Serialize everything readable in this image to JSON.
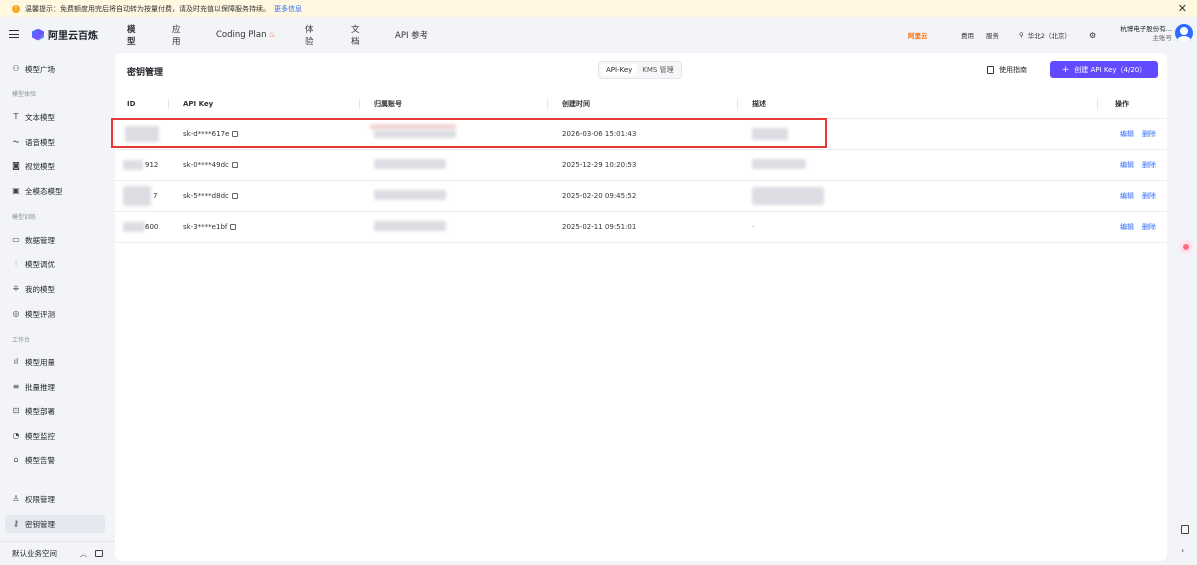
{
  "notice": {
    "text": "温馨提示：免费额度用完后将自动转为按量付费，请及时充值以保障服务持续。",
    "more": "更多信息"
  },
  "header": {
    "brand": "阿里云百炼",
    "nav": [
      "模型",
      "应用",
      "Coding Plan",
      "体验",
      "文档",
      "API 参考"
    ],
    "tools": [
      "阿里云",
      "费用",
      "服务",
      "华北2（北京）"
    ],
    "account_name": "杭博电子股份有...",
    "account_role": "主账号"
  },
  "sidebar": {
    "groups": [
      "模型体验",
      "模型训练",
      "工作台"
    ],
    "items": [
      {
        "label": "模型广场",
        "icon": "model-plaza-icon",
        "glyph": "⚇"
      },
      {
        "label": "文本模型",
        "icon": "text-icon",
        "glyph": "T"
      },
      {
        "label": "语音模型",
        "icon": "audio-wave-icon",
        "glyph": "⏦"
      },
      {
        "label": "视觉模型",
        "icon": "camera-icon",
        "glyph": "◙"
      },
      {
        "label": "全模态模型",
        "icon": "multimodal-icon",
        "glyph": "▣"
      },
      {
        "label": "数据管理",
        "icon": "data-icon",
        "glyph": "▭"
      },
      {
        "label": "模型调优",
        "icon": "tuning-icon",
        "glyph": "⫶"
      },
      {
        "label": "我的模型",
        "icon": "my-models-icon",
        "glyph": "⁜"
      },
      {
        "label": "模型评测",
        "icon": "evaluation-icon",
        "glyph": "◎"
      },
      {
        "label": "模型用量",
        "icon": "usage-chart-icon",
        "glyph": "ıl"
      },
      {
        "label": "批量推理",
        "icon": "batch-icon",
        "glyph": "≡"
      },
      {
        "label": "模型部署",
        "icon": "deploy-icon",
        "glyph": "⊡"
      },
      {
        "label": "模型监控",
        "icon": "monitor-icon",
        "glyph": "◔"
      },
      {
        "label": "模型告警",
        "icon": "alert-icon",
        "glyph": "⌂"
      },
      {
        "label": "权限管理",
        "icon": "user-icon",
        "glyph": "♙"
      },
      {
        "label": "密钥管理",
        "icon": "key-icon",
        "glyph": "⚷"
      }
    ],
    "workspace": "默认业务空间"
  },
  "page": {
    "title": "密钥管理",
    "tabs": [
      "API-Key",
      "KMS 管理"
    ],
    "guide": "使用指南",
    "create": "创建 API Key（4/20）"
  },
  "table": {
    "headers": [
      "ID",
      "API Key",
      "归属账号",
      "创建时间",
      "描述",
      "操作"
    ],
    "rows": [
      {
        "id": "",
        "key": "sk-d****617e",
        "created": "2026-03-06 15:01:43",
        "desc": ""
      },
      {
        "id": "912",
        "key": "sk-0****49dc",
        "created": "2025-12-29 10:20:53",
        "desc": ""
      },
      {
        "id": "7",
        "key": "sk-5****d8dc",
        "created": "2025-02-20 09:45:52",
        "desc": ""
      },
      {
        "id": "600",
        "key": "sk-3****e1bf",
        "created": "2025-02-11 09:51:01",
        "desc": "-"
      }
    ],
    "actions": [
      "编辑",
      "删除"
    ]
  },
  "colors": {
    "accent": "#624aff",
    "link": "#2f6bff",
    "highlight": "#e53935"
  }
}
